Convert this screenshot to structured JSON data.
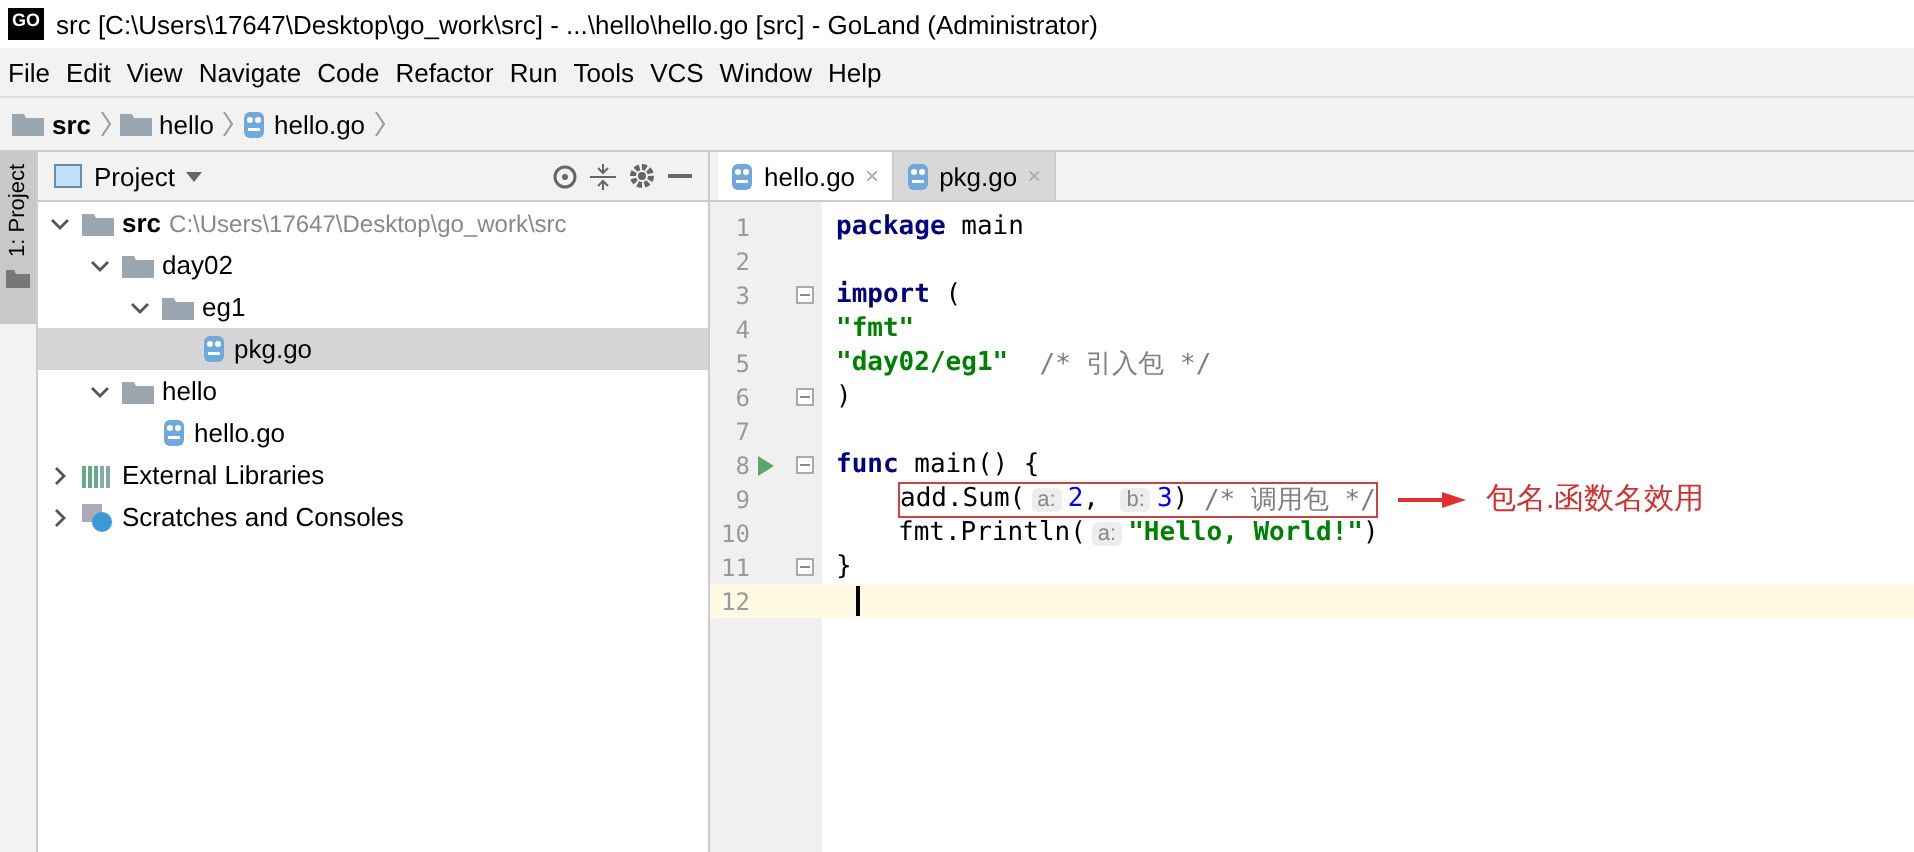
{
  "window": {
    "title": "src [C:\\Users\\17647\\Desktop\\go_work\\src] - ...\\hello\\hello.go [src] - GoLand (Administrator)",
    "logo": "GO"
  },
  "menu": [
    "File",
    "Edit",
    "View",
    "Navigate",
    "Code",
    "Refactor",
    "Run",
    "Tools",
    "VCS",
    "Window",
    "Help"
  ],
  "breadcrumb": [
    {
      "label": "src",
      "kind": "folder",
      "bold": true
    },
    {
      "label": "hello",
      "kind": "folder",
      "bold": false
    },
    {
      "label": "hello.go",
      "kind": "file",
      "bold": false
    }
  ],
  "side_tab": {
    "label": "1: Project",
    "selected": true
  },
  "project_panel": {
    "title": "Project",
    "tree": [
      {
        "name": "src",
        "note": "C:\\Users\\17647\\Desktop\\go_work\\src",
        "kind": "folder",
        "bold": true,
        "expanded": true,
        "selected": false,
        "children": [
          {
            "name": "day02",
            "kind": "folder",
            "expanded": true,
            "selected": false,
            "children": [
              {
                "name": "eg1",
                "kind": "folder",
                "expanded": true,
                "selected": false,
                "children": [
                  {
                    "name": "pkg.go",
                    "kind": "file",
                    "selected": true
                  }
                ]
              }
            ]
          },
          {
            "name": "hello",
            "kind": "folder",
            "expanded": true,
            "selected": false,
            "children": [
              {
                "name": "hello.go",
                "kind": "file",
                "selected": false
              }
            ]
          }
        ]
      },
      {
        "name": "External Libraries",
        "kind": "library",
        "expanded": false,
        "selected": false
      },
      {
        "name": "Scratches and Consoles",
        "kind": "scratches",
        "expanded": false,
        "selected": false
      }
    ]
  },
  "editor_tabs": [
    {
      "label": "hello.go",
      "close": "×",
      "selected": true
    },
    {
      "label": "pkg.go",
      "close": "×",
      "selected": false
    }
  ],
  "code": [
    {
      "number": "1",
      "tokens": [
        {
          "kind": "keyword",
          "text": "package"
        },
        {
          "kind": "plain",
          "text": " main"
        }
      ]
    },
    {
      "number": "2"
    },
    {
      "number": "3",
      "fold": true,
      "tokens": [
        {
          "kind": "keyword",
          "text": "import"
        },
        {
          "kind": "plain",
          "text": " ("
        }
      ]
    },
    {
      "number": "4",
      "tokens": [
        {
          "kind": "string",
          "text": "\"fmt\""
        }
      ]
    },
    {
      "number": "5",
      "tokens": [
        {
          "kind": "string",
          "text": "\"day02/eg1\""
        },
        {
          "kind": "comment",
          "text": "  /* 引入包 */"
        }
      ]
    },
    {
      "number": "6",
      "fold": true,
      "tokens": [
        {
          "kind": "plain",
          "text": ")"
        }
      ]
    },
    {
      "number": "7"
    },
    {
      "number": "8",
      "fold": true,
      "run": true,
      "tokens": [
        {
          "kind": "keyword",
          "text": "func"
        },
        {
          "kind": "plain",
          "text": " main() {"
        }
      ]
    },
    {
      "number": "9",
      "indented": true,
      "boxed": true,
      "note": "包名.函数名效用",
      "tokens": [
        {
          "kind": "plain",
          "text": "add.Sum("
        },
        {
          "kind": "hint",
          "text": "a:"
        },
        {
          "kind": "number",
          "text": "2"
        },
        {
          "kind": "plain",
          "text": ", "
        },
        {
          "kind": "hint",
          "text": "b:"
        },
        {
          "kind": "number",
          "text": "3"
        },
        {
          "kind": "plain",
          "text": ") "
        },
        {
          "kind": "comment",
          "text": "/* 调用包 */"
        }
      ]
    },
    {
      "number": "10",
      "indented": true,
      "tokens": [
        {
          "kind": "plain",
          "text": "fmt.Println("
        },
        {
          "kind": "hint",
          "text": "a:"
        },
        {
          "kind": "string",
          "text": "\"Hello, World!\""
        },
        {
          "kind": "plain",
          "text": ")"
        }
      ]
    },
    {
      "number": "11",
      "fold": true,
      "tokens": [
        {
          "kind": "plain",
          "text": "}"
        }
      ]
    },
    {
      "number": "12",
      "current": true
    }
  ]
}
